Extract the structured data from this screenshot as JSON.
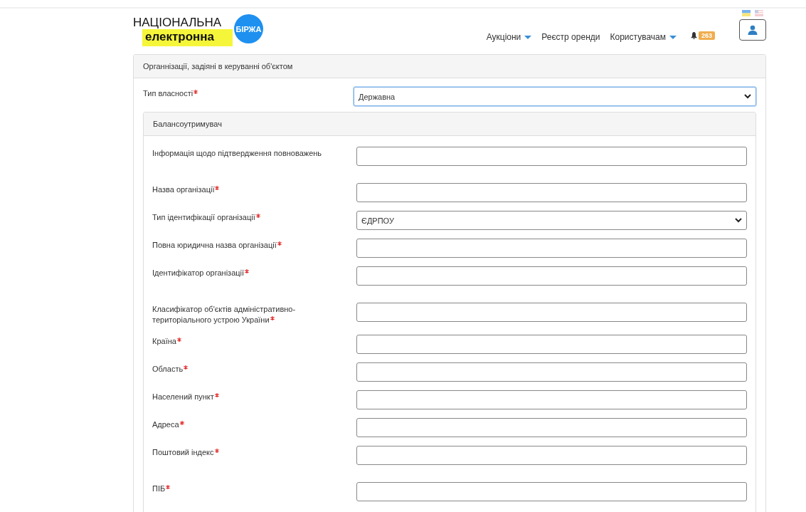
{
  "logo": {
    "line_1": "НАЦІОНАЛЬНА",
    "line_2": "електронна",
    "badge": "БІРЖА"
  },
  "nav": [
    {
      "label": "Аукціони",
      "dropdown": true
    },
    {
      "label": "Реєстр оренди",
      "dropdown": false
    },
    {
      "label": "Користувачам",
      "dropdown": true
    }
  ],
  "notifications": {
    "count": "263"
  },
  "panel": {
    "title": "Органнізації, задіяні в керуванні об'єктом",
    "ownership": {
      "label": "Тип власності",
      "required": true,
      "kind": "select",
      "value": "Державна",
      "focused": true
    },
    "subpanel": {
      "title": "Балансоутримувач",
      "groups": [
        [
          {
            "label": "Інформація щодо підтвердження повноважень",
            "required": false,
            "kind": "input"
          }
        ],
        [
          {
            "label": "Назва організації",
            "required": true,
            "kind": "input"
          },
          {
            "label": "Тип ідентифікації організації",
            "required": true,
            "kind": "select",
            "value": "ЄДРПОУ"
          },
          {
            "label": "Повна юридична назва організації",
            "required": true,
            "kind": "input"
          },
          {
            "label": "Ідентифікатор організації",
            "required": true,
            "kind": "input"
          }
        ],
        [
          {
            "label": "Класифікатор об'єктів адміністративно-територіального устрою України",
            "required": true,
            "kind": "input"
          },
          {
            "label": "Країна",
            "required": true,
            "kind": "input"
          },
          {
            "label": "Область",
            "required": true,
            "kind": "input"
          },
          {
            "label": "Населений пункт",
            "required": true,
            "kind": "input"
          },
          {
            "label": "Адреса",
            "required": true,
            "kind": "input"
          },
          {
            "label": "Поштовий індекс",
            "required": true,
            "kind": "input"
          }
        ],
        [
          {
            "label": "ПІБ",
            "required": true,
            "kind": "input"
          }
        ]
      ]
    }
  }
}
